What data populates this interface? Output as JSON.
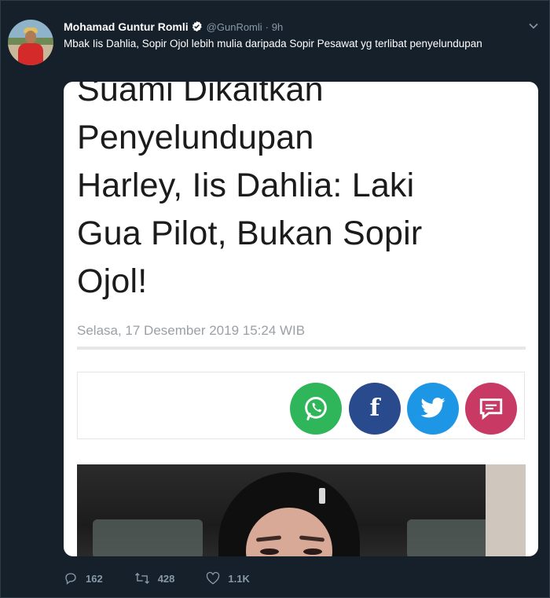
{
  "tweet": {
    "author_name": "Mohamad Guntur Romli",
    "handle": "@GunRomli",
    "separator": "·",
    "time": "9h",
    "text": "Mbak Iis Dahlia, Sopir Ojol lebih mulia daripada Sopir Pesawat yg terlibat penyelundupan"
  },
  "card": {
    "headline_partial": "Suami Dikaitkan",
    "headline_line2": "Penyelundupan",
    "headline_line3": "Harley, Iis Dahlia: Laki",
    "headline_line4": "Gua Pilot, Bukan Sopir",
    "headline_line5": "Ojol!",
    "date": "Selasa, 17 Desember 2019 15:24 WIB",
    "share_icons": [
      "whatsapp-icon",
      "facebook-icon",
      "twitter-icon",
      "comment-icon"
    ],
    "share_colors": {
      "whatsapp": "#2fb65a",
      "facebook": "#2a4a8e",
      "twitter": "#1d96e5",
      "comment": "#c83a64"
    }
  },
  "actions": {
    "replies": "162",
    "retweets": "428",
    "likes": "1.1K"
  },
  "colors": {
    "background": "#15202b",
    "muted": "#8899a6",
    "verified": "#ffffff"
  }
}
